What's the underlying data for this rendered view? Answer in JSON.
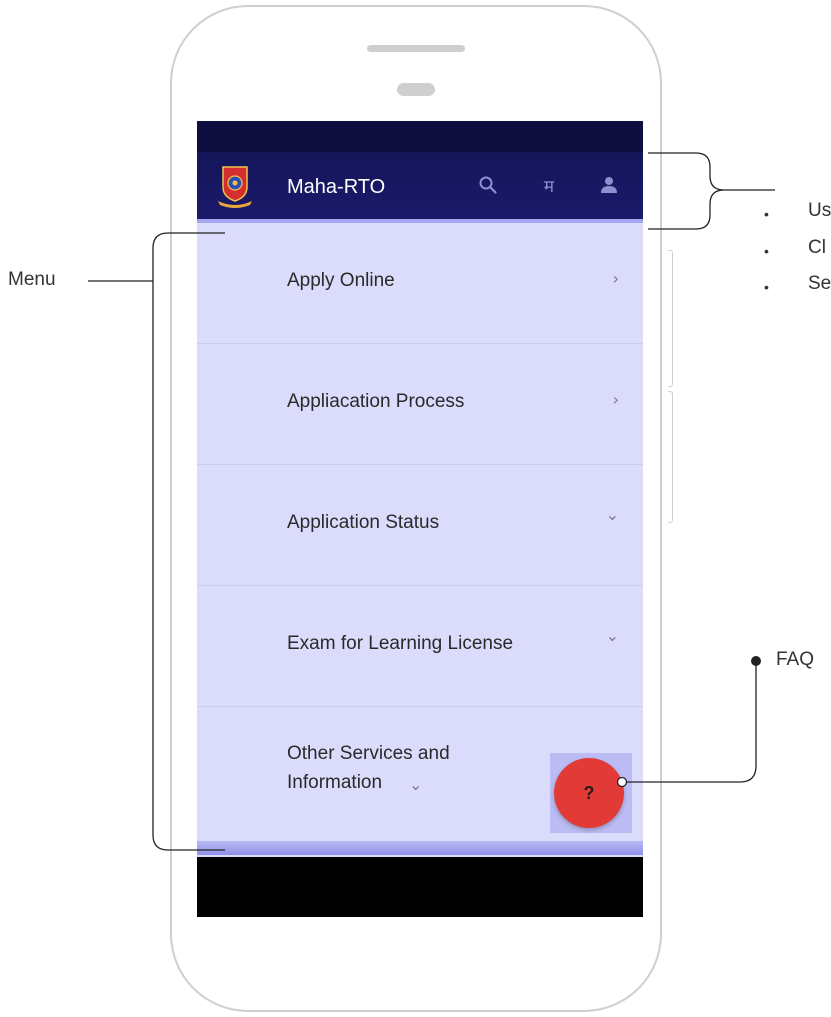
{
  "app": {
    "title": "Maha-RTO",
    "language_toggle_label": "म"
  },
  "menu": {
    "items": [
      {
        "label": "Apply Online",
        "chevron": "›"
      },
      {
        "label": "Appliacation Process",
        "chevron": "›"
      },
      {
        "label": "Application Status",
        "chevron": "⌄"
      },
      {
        "label": "Exam for Learning License",
        "chevron": "⌄"
      },
      {
        "label_line1": "Other Services and",
        "label_line2": "Information",
        "chevron": "⌄"
      }
    ]
  },
  "faq": {
    "label": "?"
  },
  "annotations": {
    "menu": "Menu",
    "faq": "FAQ",
    "header_bullets": [
      "Us",
      "Cl",
      "Se"
    ]
  },
  "icons": {
    "search": "search-icon",
    "language": "language-toggle",
    "profile": "profile-icon",
    "logo": "rto-emblem-logo"
  },
  "colors": {
    "appbar": "#1a1a6b",
    "menu_bg": "#dbdbfb",
    "faq": "#e23b37"
  }
}
